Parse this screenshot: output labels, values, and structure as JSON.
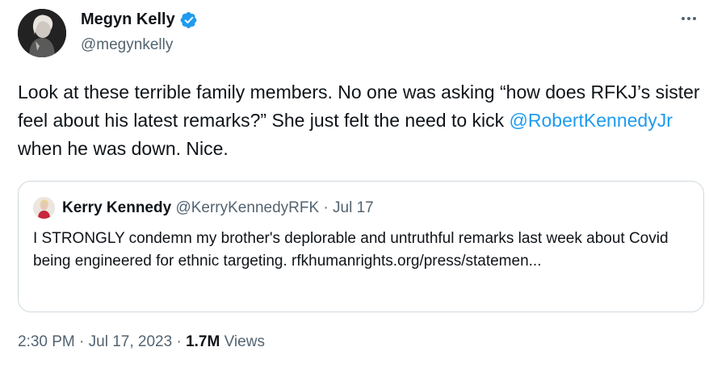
{
  "author": {
    "name": "Megyn Kelly",
    "handle": "@megynkelly",
    "verified": true
  },
  "tweet": {
    "text_before": "Look at these terrible family members. No one was asking “how does RFKJ’s sister feel about his latest remarks?” She just felt the need to kick ",
    "mention": "@RobertKennedyJr",
    "text_after": " when he was down. Nice."
  },
  "quote": {
    "name": "Kerry Kennedy",
    "handle": "@KerryKennedyRFK",
    "separator": " · ",
    "date": "Jul 17",
    "text": "I STRONGLY condemn my brother's deplorable and untruthful remarks last week about Covid being engineered for ethnic targeting. rfkhumanrights.org/press/statemen..."
  },
  "footer": {
    "time": "2:30 PM",
    "separator": " · ",
    "date": "Jul 17, 2023",
    "separator2": " · ",
    "views_count": "1.7M",
    "views_label": " Views"
  },
  "colors": {
    "link": "#1d9bf0",
    "secondary_text": "#536471",
    "border": "#cfd9de",
    "verified_badge": "#1d9bf0"
  },
  "icons": {
    "verified": "verified-badge-icon",
    "more": "more-horizontal-icon"
  }
}
